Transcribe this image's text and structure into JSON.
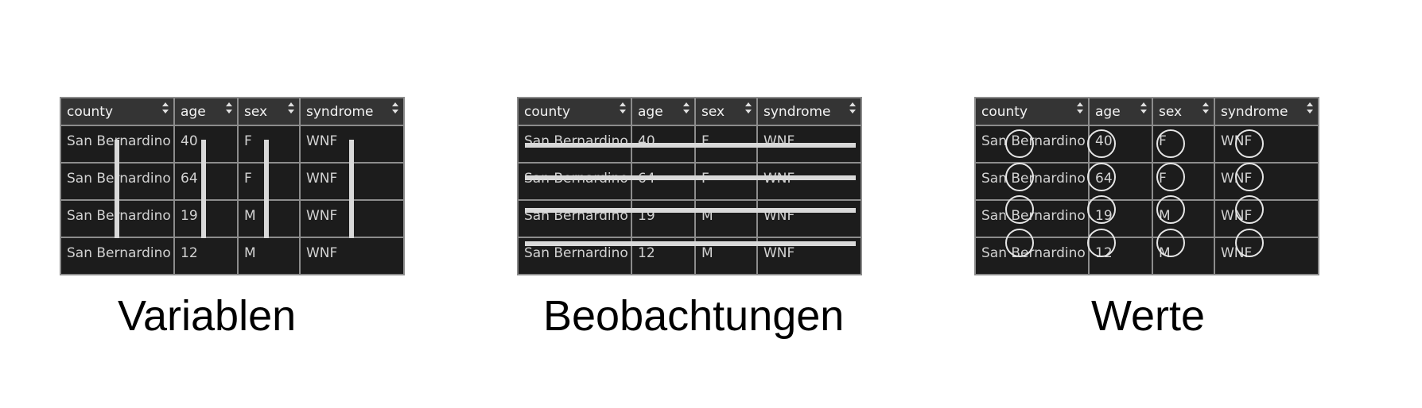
{
  "table": {
    "headers": [
      "county",
      "age",
      "sex",
      "syndrome"
    ],
    "rows": [
      [
        "San Bernardino",
        "40",
        "F",
        "WNF"
      ],
      [
        "San Bernardino",
        "64",
        "F",
        "WNF"
      ],
      [
        "San Bernardino",
        "19",
        "M",
        "WNF"
      ],
      [
        "San Bernardino",
        "12",
        "M",
        "WNF"
      ]
    ]
  },
  "panels": [
    {
      "caption": "Variablen",
      "highlight": "columns"
    },
    {
      "caption": "Beobachtungen",
      "highlight": "rows"
    },
    {
      "caption": "Werte",
      "highlight": "cells"
    }
  ],
  "colors": {
    "table_background": "#1c1c1c",
    "header_background": "#343434",
    "grid_line": "#8c8c8c",
    "highlight": "#d9d9d9"
  },
  "icons": [
    "sort-icon"
  ]
}
